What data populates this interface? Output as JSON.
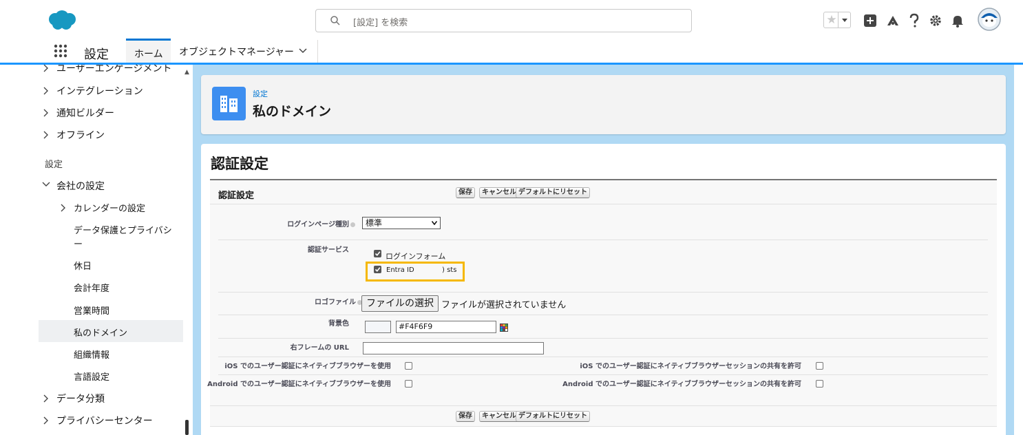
{
  "header": {
    "search_placeholder": "[設定] を検索",
    "icons": [
      "salesforce-cloud-logo",
      "search-icon",
      "favorite-star-icon",
      "dropdown-icon",
      "add-icon",
      "trailhead-icon",
      "help-icon",
      "gear-icon",
      "bell-icon",
      "avatar"
    ]
  },
  "nav": {
    "app_name": "設定",
    "tab_home": "ホーム",
    "tab_object_manager": "オブジェクトマネージャー"
  },
  "sidebar": {
    "items": [
      {
        "label": "ユーザーエンゲージメント",
        "chevron": "right"
      },
      {
        "label": "インテグレーション",
        "chevron": "right"
      },
      {
        "label": "通知ビルダー",
        "chevron": "right"
      },
      {
        "label": "オフライン",
        "chevron": "right"
      }
    ],
    "section_label": "設定",
    "company_settings": "会社の設定",
    "sub_items": [
      "カレンダーの設定",
      "データ保護とプライバシ",
      "ー",
      "休日",
      "会計年度",
      "営業時間",
      "私のドメイン",
      "組織情報",
      "言語設定"
    ],
    "bottom_items": [
      "データ分類",
      "プライバシーセンター"
    ],
    "selected": "私のドメイン"
  },
  "page_header": {
    "breadcrumb": "設定",
    "title": "私のドメイン"
  },
  "content": {
    "heading": "認証設定",
    "block_title": "認証設定",
    "buttons": {
      "save": "保存",
      "cancel": "キャンセル",
      "reset": "デフォルトにリセット"
    },
    "login_page_type_label": "ログインページ種別",
    "login_page_type_value": "標準",
    "auth_service_label": "認証サービス",
    "auth_options": [
      {
        "label": "ログインフォーム",
        "checked": true
      },
      {
        "label": "Entra ID",
        "suffix": ") sts",
        "checked": true
      }
    ],
    "logo_file_label": "ロゴファイル",
    "file_button": "ファイルの選択",
    "file_status": "ファイルが選択されていません",
    "bg_color_label": "背景色",
    "bg_color_value": "#F4F6F9",
    "right_frame_url_label": "右フレームの URL",
    "ios_native_browser_label": "iOS でのユーザー認証にネイティブブラウザーを使用",
    "ios_session_share_label": "iOS でのユーザー認証にネイティブブラウザーセッションの共有を許可",
    "android_native_browser_label": "Android でのユーザー認証にネイティブブラウザーを使用",
    "android_session_share_label": "Android でのユーザー認証にネイティブブラウザーセッションの共有を許可"
  },
  "colors": {
    "brand": "#0176d3",
    "main_bg": "#b0d9f4",
    "highlight_border": "#f5b800",
    "page_icon_bg": "#3d8ef0"
  }
}
